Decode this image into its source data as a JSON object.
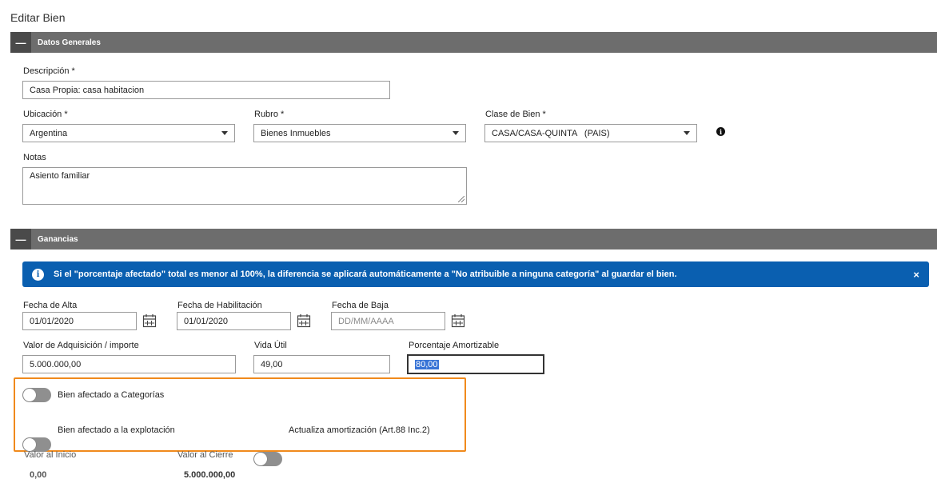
{
  "page": {
    "title": "Editar Bien"
  },
  "sections": {
    "general": {
      "toggle": "—",
      "title": "Datos Generales"
    },
    "ganancias": {
      "toggle": "—",
      "title": "Ganancias"
    }
  },
  "general": {
    "descripcion": {
      "label": "Descripción *",
      "value": "Casa Propia: casa habitacion"
    },
    "ubicacion": {
      "label": "Ubicación *",
      "value": "Argentina"
    },
    "rubro": {
      "label": "Rubro *",
      "value": "Bienes Inmuebles"
    },
    "clase": {
      "label": "Clase de Bien *",
      "value": "CASA/CASA-QUINTA   (PAIS)"
    },
    "notas": {
      "label": "Notas",
      "value": "Asiento familiar"
    },
    "info_icon": "i"
  },
  "alert": {
    "icon": "i",
    "text": "Si el \"porcentaje afectado\" total es menor al 100%, la diferencia se aplicará automáticamente a \"No atribuible a ninguna categoría\" al guardar el bien.",
    "close": "×",
    "color": "#0a5fb0"
  },
  "ganancias": {
    "fecha_alta": {
      "label": "Fecha de Alta",
      "value": "01/01/2020"
    },
    "fecha_habilitacion": {
      "label": "Fecha de Habilitación",
      "value": "01/01/2020"
    },
    "fecha_baja": {
      "label": "Fecha de Baja",
      "placeholder": "DD/MM/AAAA"
    },
    "valor_adquisicion": {
      "label": "Valor de Adquisición / importe",
      "value": "5.000.000,00"
    },
    "vida_util": {
      "label": "Vida Útil",
      "value": "49,00"
    },
    "porcentaje_amortizable": {
      "label": "Porcentaje Amortizable",
      "value": "80,00"
    },
    "toggles": {
      "categorias": {
        "label": "Bien afectado a Categorías",
        "on": false
      },
      "explotacion": {
        "label": "Bien afectado a la explotación",
        "on": false
      },
      "amortizacion": {
        "label": "Actualiza amortización (Art.88 Inc.2)",
        "on": false
      }
    },
    "valor_inicio": {
      "label": "Valor al Inicio",
      "value": "0,00"
    },
    "valor_cierre": {
      "label": "Valor al Cierre",
      "value": "5.000.000,00"
    }
  },
  "colors": {
    "section_bar": "#6d6d6d",
    "highlight": "#f08a1c"
  }
}
